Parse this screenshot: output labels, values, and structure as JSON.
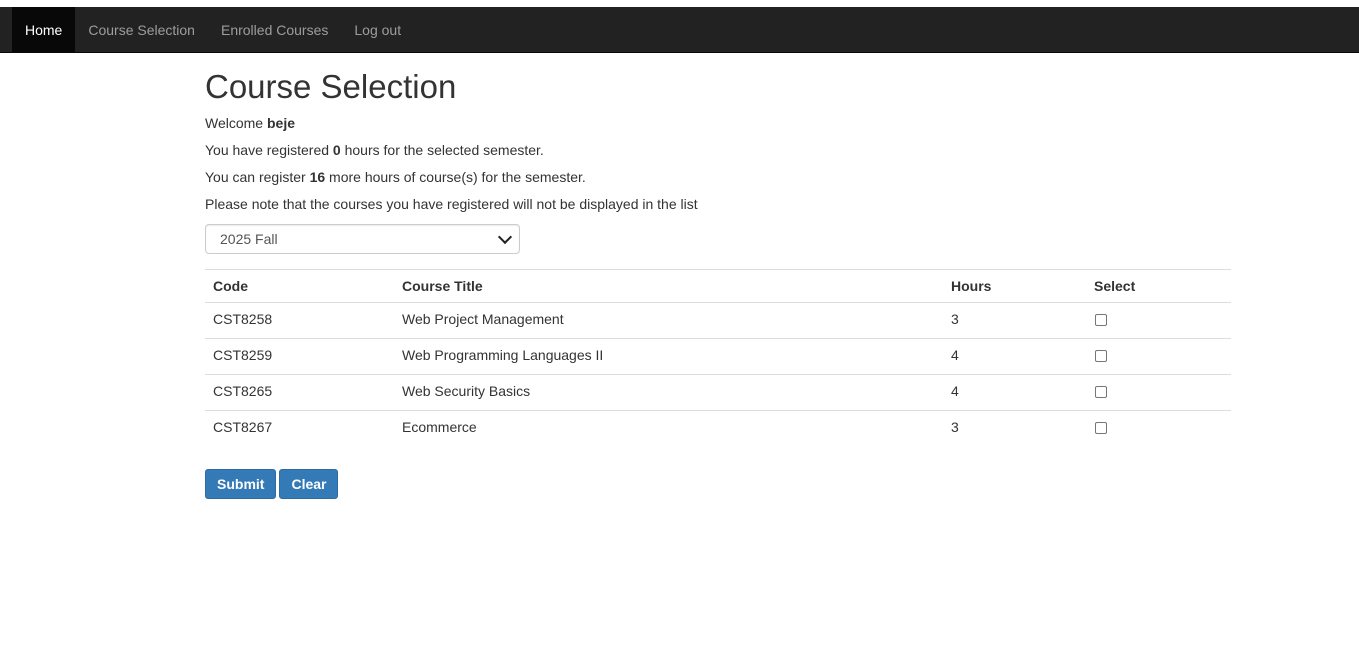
{
  "nav": {
    "items": [
      {
        "label": "Home",
        "active": true
      },
      {
        "label": "Course Selection",
        "active": false
      },
      {
        "label": "Enrolled Courses",
        "active": false
      },
      {
        "label": "Log out",
        "active": false
      }
    ]
  },
  "page": {
    "title": "Course Selection",
    "welcome_prefix": "Welcome ",
    "username": "beje",
    "registered_prefix": "You have registered ",
    "registered_hours": "0",
    "registered_suffix": " hours for the selected semester.",
    "remaining_prefix": "You can register ",
    "remaining_hours": "16",
    "remaining_suffix": " more hours of course(s) for the semester.",
    "note": "Please note that the courses you have registered will not be displayed in the list"
  },
  "semester": {
    "selected": "2025 Fall"
  },
  "table": {
    "headers": {
      "code": "Code",
      "title": "Course Title",
      "hours": "Hours",
      "select": "Select"
    },
    "rows": [
      {
        "code": "CST8258",
        "title": "Web Project Management",
        "hours": "3",
        "selected": false
      },
      {
        "code": "CST8259",
        "title": "Web Programming Languages II",
        "hours": "4",
        "selected": false
      },
      {
        "code": "CST8265",
        "title": "Web Security Basics",
        "hours": "4",
        "selected": false
      },
      {
        "code": "CST8267",
        "title": "Ecommerce",
        "hours": "3",
        "selected": false
      }
    ]
  },
  "buttons": {
    "submit_label": "Submit",
    "clear_label": "Clear"
  },
  "colors": {
    "navbar_bg": "#222222",
    "navbar_active_bg": "#080808",
    "primary_button": "#337ab7"
  }
}
